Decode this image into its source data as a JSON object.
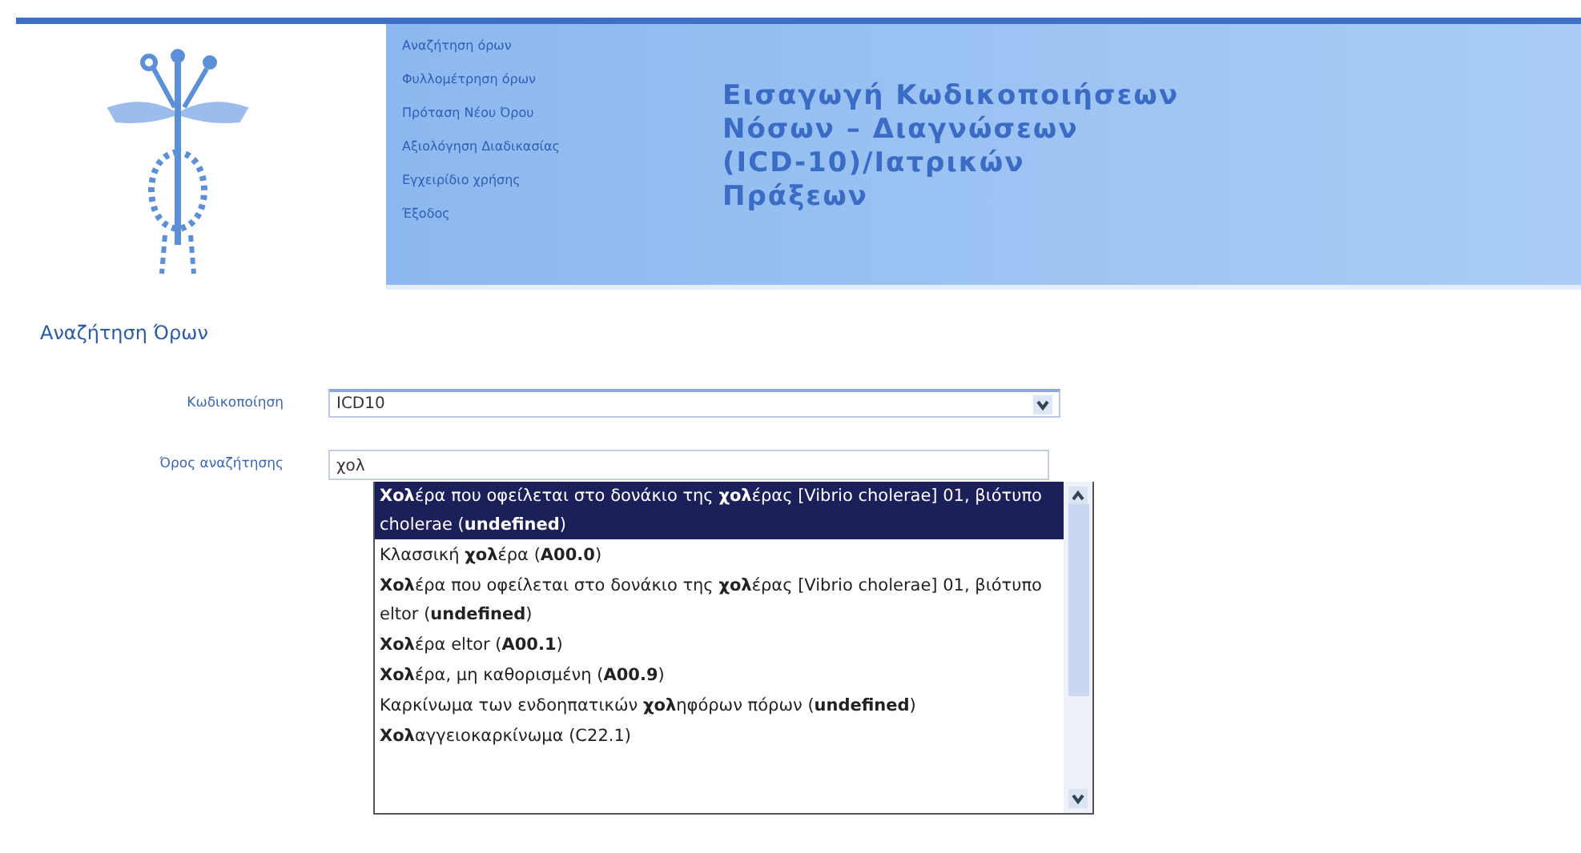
{
  "nav": {
    "items": [
      {
        "label": "Αναζήτηση όρων"
      },
      {
        "label": "Φυλλομέτρηση όρων"
      },
      {
        "label": "Πρόταση Νέου Όρου"
      },
      {
        "label": "Αξιολόγηση Διαδικασίας"
      },
      {
        "label": "Εγχειρίδιο χρήσης"
      },
      {
        "label": "Έξοδος"
      }
    ]
  },
  "banner": {
    "title_lines": [
      "Εισαγωγή Κωδικοποιήσεων",
      "Νόσων – Διαγνώσεων",
      "(ICD-10)/Ιατρικών",
      "Πράξεων"
    ]
  },
  "page_heading": "Αναζήτηση Όρων",
  "form": {
    "fields": [
      {
        "kind": "select",
        "label": "Κωδικοποίηση",
        "value": "ICD10"
      },
      {
        "kind": "text",
        "label": "Όρος αναζήτησης",
        "value": "χολ"
      }
    ]
  },
  "suggestions": {
    "items": [
      {
        "text": "**Χολ**έρα που οφείλεται στο δονάκιο της **χολ**έρας [Vibrio cholerae] 01, βιότυπο cholerae (**undefined**)",
        "selected": true
      },
      {
        "text": "Κλασσική **χολ**έρα (**A00.0**)",
        "selected": false
      },
      {
        "text": "**Χολ**έρα που οφείλεται στο δονάκιο της **χολ**έρας [Vibrio cholerae] 01, βιότυπο eltor (**undefined**)",
        "selected": false
      },
      {
        "text": "**Χολ**έρα eltor (**A00.1**)",
        "selected": false
      },
      {
        "text": "**Χολ**έρα, μη καθορισμένη (**A00.9**)",
        "selected": false
      },
      {
        "text": "Καρκίνωμα των ενδοηπατικών **χολ**ηφόρων πόρων (**undefined**)",
        "selected": false
      },
      {
        "text": "**Χολ**αγγειοκαρκίνωμα (C22.1)",
        "selected": false
      }
    ]
  }
}
